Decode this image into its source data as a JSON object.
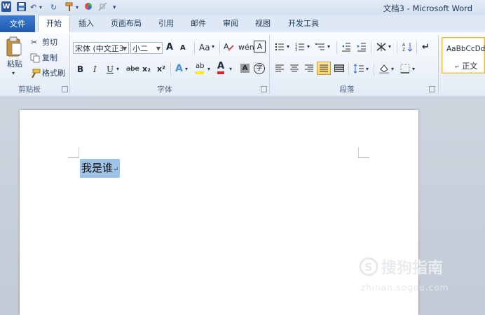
{
  "window": {
    "title": "文档3 - Microsoft Word"
  },
  "qat": {
    "word_logo": "W",
    "undo_label": "↶",
    "redo_label": "↻",
    "dropdown": "▾"
  },
  "tabs": [
    {
      "label": "文件"
    },
    {
      "label": "开始"
    },
    {
      "label": "插入"
    },
    {
      "label": "页面布局"
    },
    {
      "label": "引用"
    },
    {
      "label": "邮件"
    },
    {
      "label": "审阅"
    },
    {
      "label": "视图"
    },
    {
      "label": "开发工具"
    }
  ],
  "clipboard": {
    "paste": "粘贴",
    "cut": "剪切",
    "copy": "复制",
    "format_painter": "格式刷",
    "group": "剪贴板"
  },
  "font": {
    "name": "宋体 (中文正3",
    "size": "小二",
    "group": "字体",
    "grow": "A",
    "shrink": "A",
    "case": "Aa",
    "clear": "A",
    "bold": "B",
    "italic": "I",
    "underline": "U",
    "strike": "abe",
    "sub": "x₂",
    "sup": "x²",
    "text_effect": "A",
    "highlight": "ab",
    "font_color": "A",
    "char_shade": "A",
    "enclose": "字",
    "phonetic": "wén",
    "charborder": "A"
  },
  "paragraph": {
    "group": "段落"
  },
  "styles": {
    "preview": "AaBbCcDd",
    "normal": "正文"
  },
  "document": {
    "text": "我是谁"
  },
  "watermark": {
    "text": "搜狗指南",
    "url": "zhinan.sogou.com"
  }
}
